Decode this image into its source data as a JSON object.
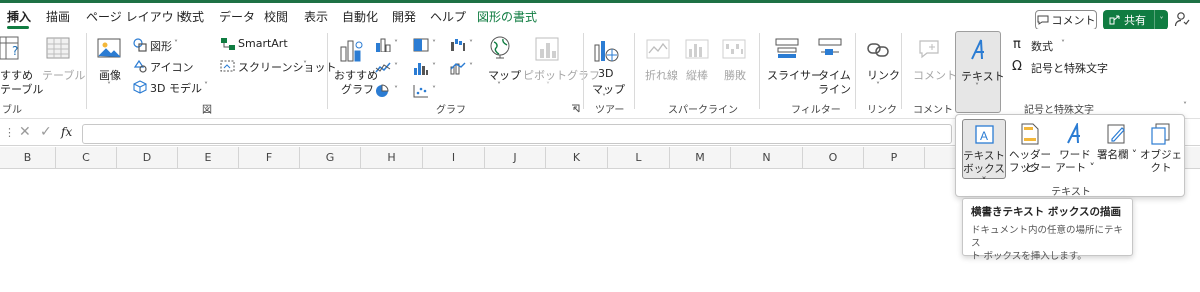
{
  "tabs": [
    {
      "label": "挿入",
      "active": true
    },
    {
      "label": "描画"
    },
    {
      "label": "ページ レイアウト"
    },
    {
      "label": "数式"
    },
    {
      "label": "データ"
    },
    {
      "label": "校閲"
    },
    {
      "label": "表示"
    },
    {
      "label": "自動化"
    },
    {
      "label": "開発"
    },
    {
      "label": "ヘルプ"
    },
    {
      "label": "図形の書式",
      "contextual": true
    }
  ],
  "header": {
    "comment_label": "コメント",
    "share_label": "共有",
    "accent_color": "#107c41"
  },
  "ribbon": {
    "tables": {
      "recommended_pivot_l1": "すすめ",
      "recommended_pivot_l2": "テーブル",
      "table": "テーブル",
      "group": "ブル"
    },
    "illustrations": {
      "image": "画像",
      "shapes": "図形",
      "icons": "アイコン",
      "model3d": "3D モデル",
      "smartart": "SmartArt",
      "screenshot": "スクリーンショット",
      "group": "図"
    },
    "charts": {
      "recommended_l1": "おすすめ",
      "recommended_l2": "グラフ",
      "map": "マップ",
      "pivotchart": "ピボットグラフ",
      "group": "グラフ"
    },
    "tours": {
      "map3d_l1": "3D",
      "map3d_l2": "マップ",
      "group": "ツアー"
    },
    "sparklines": {
      "line": "折れ線",
      "column": "縦棒",
      "winloss": "勝敗",
      "group": "スパークライン"
    },
    "filters": {
      "slicer": "スライサー",
      "timeline_l1": "タイム",
      "timeline_l2": "ライン",
      "group": "フィルター"
    },
    "links": {
      "link": "リンク",
      "group": "リンク"
    },
    "comments": {
      "comment": "コメント",
      "group": "コメント"
    },
    "text": {
      "text": "テキスト"
    },
    "symbols": {
      "equation": "数式",
      "symbol": "記号と特殊文字",
      "group": "記号と特殊文字"
    }
  },
  "formula_bar": {
    "fx": "fx",
    "value": ""
  },
  "columns": [
    "B",
    "C",
    "D",
    "E",
    "F",
    "G",
    "H",
    "I",
    "J",
    "K",
    "L",
    "M",
    "N",
    "O",
    "P"
  ],
  "text_dropdown": {
    "items": [
      {
        "l1": "テキスト",
        "l2": "ボックス ˅"
      },
      {
        "l1": "ヘッダーと",
        "l2": "フッター"
      },
      {
        "l1": "ワード",
        "l2": "アート ˅"
      },
      {
        "l1": "署名欄 ˅",
        "l2": ""
      },
      {
        "l1": "オブジェクト",
        "l2": ""
      }
    ],
    "group": "テキスト"
  },
  "tooltip": {
    "title": "横書きテキスト ボックスの描画",
    "line1": "ドキュメント内の任意の場所にテキス",
    "line2": "ト ボックスを挿入します。"
  }
}
